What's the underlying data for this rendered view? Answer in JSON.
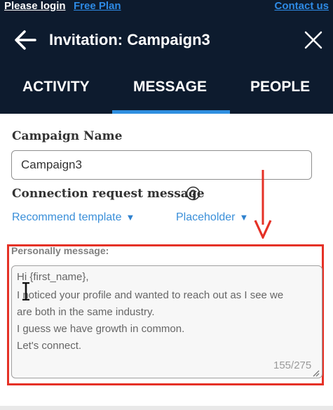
{
  "top_strip": {
    "login": "Please login",
    "plan": "Free Plan",
    "contact": "Contact us"
  },
  "header": {
    "title": "Invitation: Campaign3",
    "back_icon": "arrow-left-icon",
    "close_icon": "close-icon"
  },
  "tabs": [
    {
      "label": "ACTIVITY",
      "active": false
    },
    {
      "label": "MESSAGE",
      "active": true
    },
    {
      "label": "PEOPLE",
      "active": false
    }
  ],
  "form": {
    "campaign_name_label": "Campaign Name",
    "campaign_name_value": "Campaign3",
    "connection_label": "Connection request message",
    "help_icon": "question-circle-icon",
    "recommend_link": "Recommend template",
    "placeholder_link": "Placeholder",
    "caret": "▼"
  },
  "message": {
    "label": "Personally message:",
    "lines": [
      "Hi {first_name},",
      "I noticed your profile and wanted to reach out as I see we",
      "are both in the same industry.",
      "I guess we have growth in common.",
      "Let's connect."
    ],
    "counter": "155/275"
  },
  "colors": {
    "header_bg": "#0d1b2e",
    "accent_blue": "#2f8fe0",
    "link_blue": "#3a8fd9",
    "highlight_red": "#e53126"
  }
}
